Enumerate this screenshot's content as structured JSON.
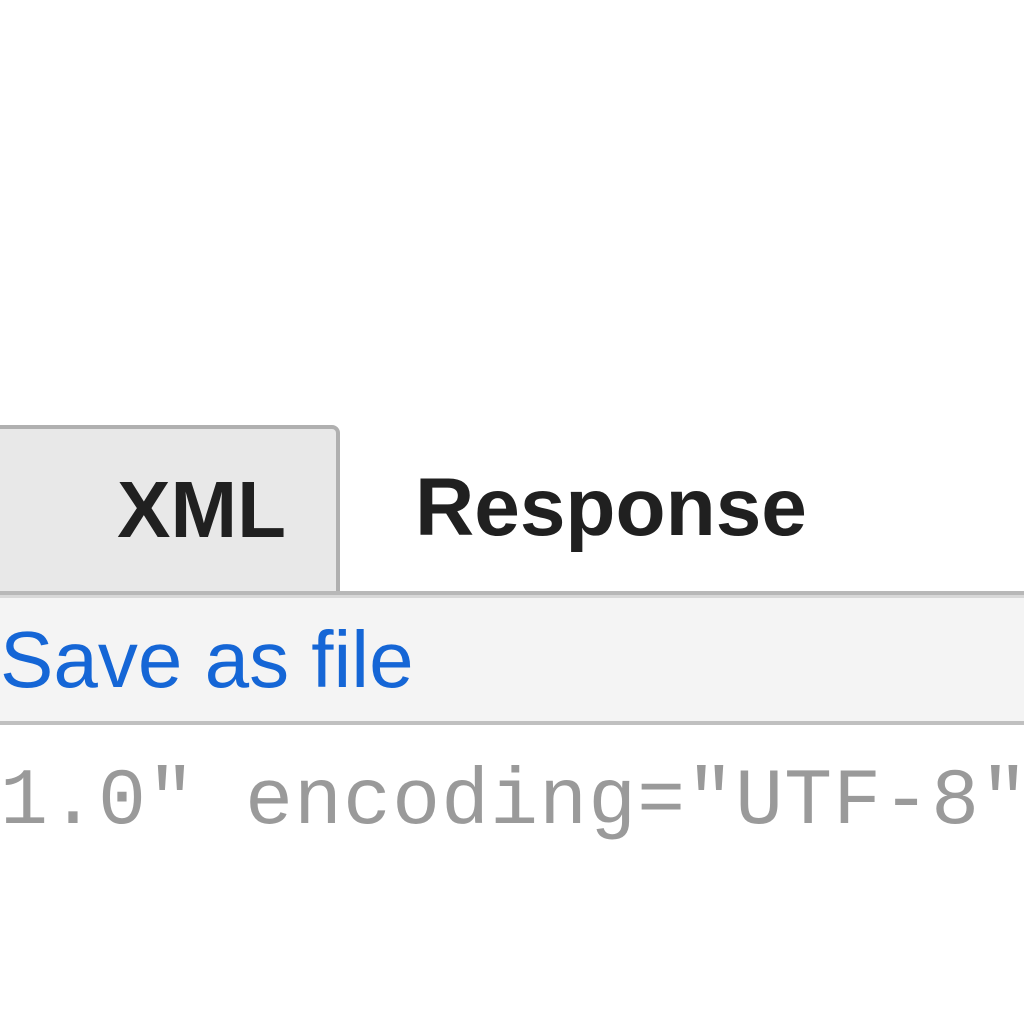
{
  "tabs": {
    "active_label": "XML",
    "response_label": "Response"
  },
  "toolbar": {
    "save_as_file": "Save as file"
  },
  "content": {
    "xml_declaration_fragment": "1.0\" encoding=\"UTF-8\""
  }
}
